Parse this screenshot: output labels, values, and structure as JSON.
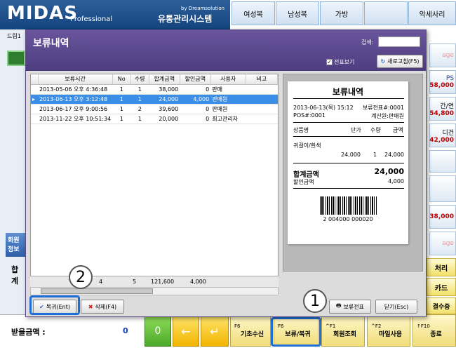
{
  "app": {
    "logo": "MIDAS",
    "logo_sub": "Professional",
    "brand_top": "by Dreamsolution",
    "brand_main": "유통관리시스템",
    "left_label": "드림1",
    "member_tab": "회원\n정보",
    "total_label": "합계",
    "received_label": "받을금액 :",
    "received_value": "0"
  },
  "categories": [
    "여성복",
    "남성복",
    "가방",
    "",
    "악세사리"
  ],
  "right_tiles": [
    {
      "label": "age",
      "price": ""
    },
    {
      "label": "PS",
      "price": "58,000"
    },
    {
      "label": "간/연",
      "price": "54,800"
    },
    {
      "label": "디건",
      "price": "42,000"
    },
    {
      "label": "",
      "price": ""
    },
    {
      "label": "",
      "price": "38,000"
    },
    {
      "label": "age",
      "price": ""
    }
  ],
  "right_actions": [
    "처리",
    "카드",
    "결수증"
  ],
  "bottom_keys": {
    "zero": "0",
    "fkeys": [
      {
        "key": "F6",
        "label": "기초수신"
      },
      {
        "key": "F6",
        "label": "보류/복귀"
      },
      {
        "key": "^F1",
        "label": "회원조회"
      },
      {
        "key": "^F2",
        "label": "마일사용"
      },
      {
        "key": "↑F10",
        "label": "종료"
      }
    ]
  },
  "dialog": {
    "title": "보류내역",
    "search_label": "검색:",
    "slip_view_label": "전표보기",
    "refresh_label": "새로고침(F5)",
    "columns": [
      "보류시간",
      "No",
      "수량",
      "합계금액",
      "할인금액",
      "사용자",
      "비고"
    ],
    "rows": [
      {
        "time": "2013-05-06 오후 4:36:48",
        "no": "1",
        "qty": "1",
        "total": "38,000",
        "discount": "0",
        "user": "판매",
        "note": "",
        "selected": false
      },
      {
        "time": "2013-06-13 오후 3:12:48",
        "no": "1",
        "qty": "1",
        "total": "24,000",
        "discount": "4,000",
        "user": "판매원",
        "note": "",
        "selected": true
      },
      {
        "time": "2013-06-17 오후 9:00:56",
        "no": "1",
        "qty": "2",
        "total": "39,600",
        "discount": "0",
        "user": "판매원",
        "note": "",
        "selected": false
      },
      {
        "time": "2013-11-22 오후 10:51:34",
        "no": "1",
        "qty": "1",
        "total": "20,000",
        "discount": "0",
        "user": "최고관리자",
        "note": "",
        "selected": false
      }
    ],
    "footer": {
      "count": "4",
      "qty": "5",
      "total": "121,600",
      "discount": "4,000"
    },
    "receipt": {
      "title": "보류내역",
      "date": "2013-06-13(목) 15:12",
      "slip_no": "보류전표#:0001",
      "pos": "POS#:0001",
      "cashier": "계산원:판매원",
      "headers": [
        "상품명",
        "단가",
        "수량",
        "금액"
      ],
      "item_name": "귀걸이/흰색",
      "item_price": "24,000",
      "item_qty": "1",
      "item_amount": "24,000",
      "total_label": "합계금액",
      "total_value": "24,000",
      "discount_label": "할인금액",
      "discount_value": "4,000",
      "barcode_text": "2 004000 000020"
    },
    "buttons": {
      "restore": "복귀(Ent)",
      "delete": "삭제(F4)",
      "print_slip": "보류전표",
      "close": "닫기(Esc)"
    }
  },
  "callouts": [
    "1",
    "2"
  ],
  "colors": {
    "dialog_header": "#5a4690",
    "top_bar": "#1e4f8c",
    "selected_row": "#3a8ee6",
    "highlight": "#1f6fd6"
  }
}
